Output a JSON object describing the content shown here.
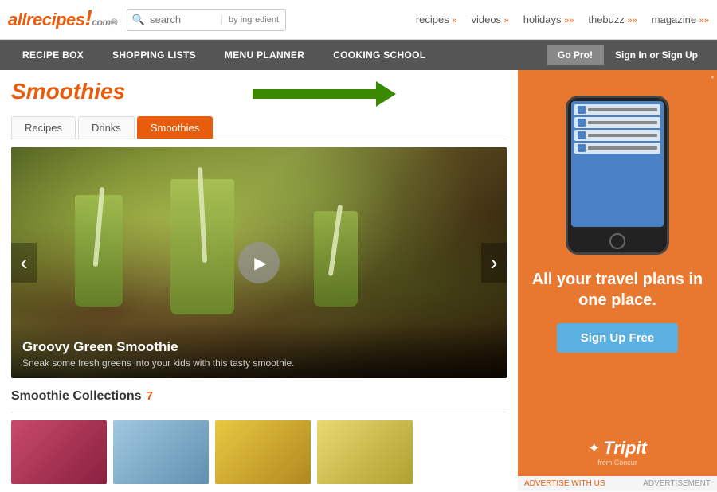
{
  "logo": {
    "site": "allrecipes",
    "dot": "!",
    "com": "com®"
  },
  "header": {
    "search_placeholder": "search",
    "by_ingredient": "by ingredient",
    "nav": [
      {
        "label": "recipes",
        "arrow": "»"
      },
      {
        "label": "videos",
        "arrow": "»"
      },
      {
        "label": "holidays",
        "arrow": "»"
      },
      {
        "label": "thebuzz",
        "arrow": "»"
      },
      {
        "label": "magazine",
        "arrow": "»"
      }
    ]
  },
  "subnav": {
    "items": [
      "RECIPE BOX",
      "SHOPPING LISTS",
      "MENU PLANNER",
      "COOKING SCHOOL"
    ],
    "go_pro": "Go Pro!",
    "sign_in": "Sign In or Sign Up"
  },
  "page": {
    "title": "Smoothies",
    "tabs": [
      "Recipes",
      "Drinks",
      "Smoothies"
    ]
  },
  "slideshow": {
    "title": "Groovy Green Smoothie",
    "description": "Sneak some fresh greens into your kids with this tasty smoothie."
  },
  "collections": {
    "title": "Smoothie Collections",
    "count": "7"
  },
  "ad": {
    "headline": "All your travel plans in one place.",
    "signup_btn": "Sign Up Free",
    "brand": "Tripit",
    "brand_sub": "from Concur",
    "advertise": "ADVERTISE WITH US",
    "label": "ADVERTISEMENT"
  }
}
